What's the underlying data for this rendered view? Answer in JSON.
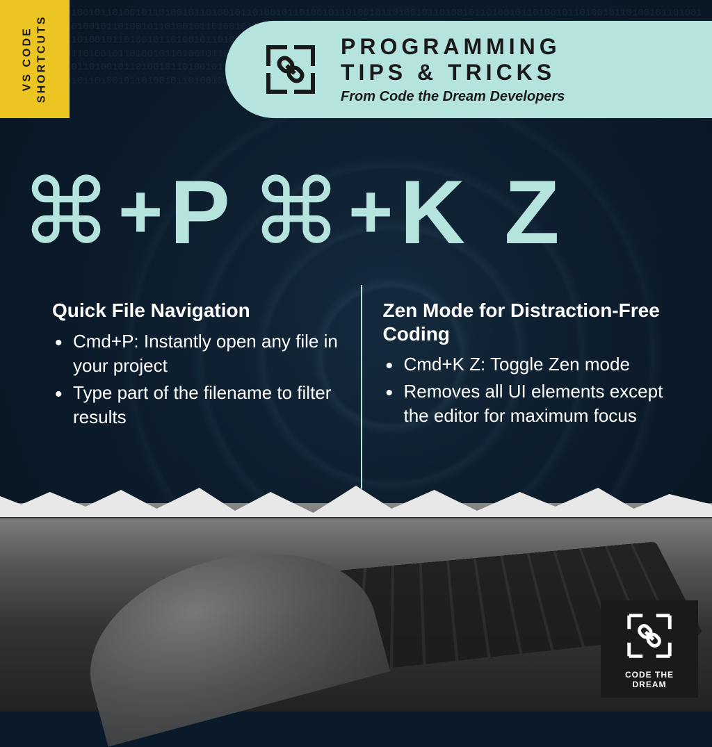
{
  "tab": {
    "line1": "VS CODE",
    "line2": "SHORTCUTS"
  },
  "header": {
    "title_line1": "PROGRAMMING",
    "title_line2": "TIPS & TRICKS",
    "subtitle": "From Code the Dream Developers"
  },
  "shortcuts": {
    "left": {
      "cmd": "⌘",
      "plus": "+",
      "key": "P"
    },
    "right": {
      "cmd": "⌘",
      "plus": "+",
      "key": "K Z"
    }
  },
  "columns": {
    "left": {
      "title": "Quick File Navigation",
      "items": [
        "Cmd+P: Instantly open any file in your project",
        "Type part of the filename to filter results"
      ]
    },
    "right": {
      "title": "Zen Mode for Distraction-Free Coding",
      "items": [
        "Cmd+K Z: Toggle Zen mode",
        "Removes all UI elements except the editor for maximum focus"
      ]
    }
  },
  "logo": {
    "text": "CODE THE DREAM"
  },
  "colors": {
    "mint": "#b5e3de",
    "yellow": "#edc523",
    "dark": "#0a1a2a"
  }
}
